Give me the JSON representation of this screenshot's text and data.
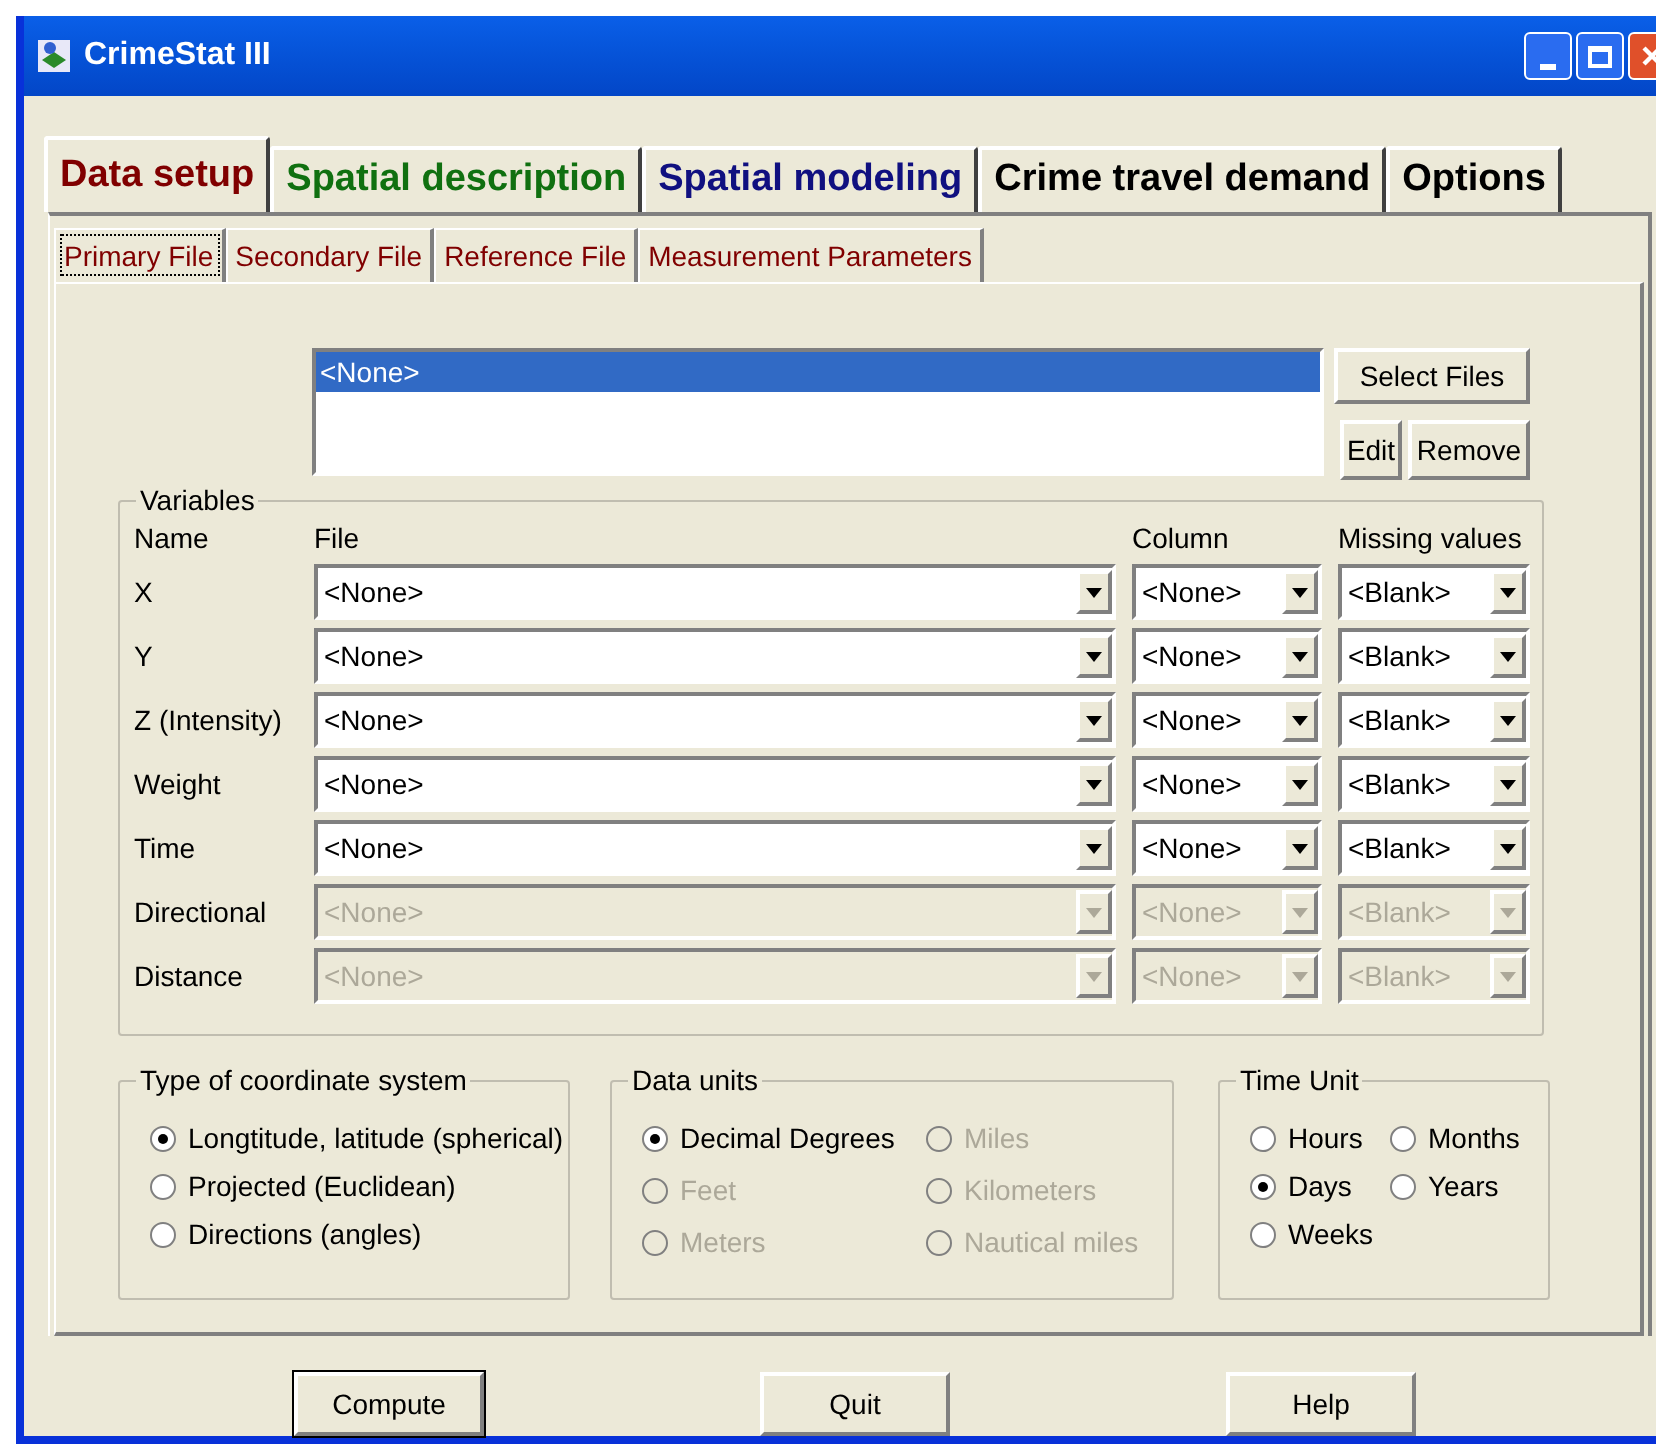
{
  "window": {
    "title": "CrimeStat III"
  },
  "tabs": [
    {
      "label": "Data setup",
      "selected": true,
      "color": "#800000"
    },
    {
      "label": "Spatial description",
      "selected": false,
      "color": "#107010"
    },
    {
      "label": "Spatial modeling",
      "selected": false,
      "color": "#101080"
    },
    {
      "label": "Crime travel demand",
      "selected": false,
      "color": "#000000"
    },
    {
      "label": "Options",
      "selected": false,
      "color": "#000000"
    }
  ],
  "subtabs": [
    {
      "label": "Primary File",
      "selected": true
    },
    {
      "label": "Secondary File",
      "selected": false
    },
    {
      "label": "Reference File",
      "selected": false
    },
    {
      "label": "Measurement Parameters",
      "selected": false
    }
  ],
  "file_list": {
    "items": [
      {
        "label": "<None>",
        "selected": true
      }
    ]
  },
  "file_buttons": [
    "Select Files",
    "Edit",
    "Remove"
  ],
  "variables": {
    "title": "Variables",
    "headers": [
      "Name",
      "File",
      "Column",
      "Missing values"
    ],
    "rows": [
      {
        "name": "X",
        "file": "<None>",
        "column": "<None>",
        "missing": "<Blank>",
        "disabled": false
      },
      {
        "name": "Y",
        "file": "<None>",
        "column": "<None>",
        "missing": "<Blank>",
        "disabled": false
      },
      {
        "name": "Z (Intensity)",
        "file": "<None>",
        "column": "<None>",
        "missing": "<Blank>",
        "disabled": false
      },
      {
        "name": "Weight",
        "file": "<None>",
        "column": "<None>",
        "missing": "<Blank>",
        "disabled": false
      },
      {
        "name": "Time",
        "file": "<None>",
        "column": "<None>",
        "missing": "<Blank>",
        "disabled": false
      },
      {
        "name": "Directional",
        "file": "<None>",
        "column": "<None>",
        "missing": "<Blank>",
        "disabled": true
      },
      {
        "name": "Distance",
        "file": "<None>",
        "column": "<None>",
        "missing": "<Blank>",
        "disabled": true
      }
    ]
  },
  "coordinate_system": {
    "title": "Type of coordinate system",
    "options": [
      {
        "label": "Longtitude, latitude (spherical)",
        "selected": true,
        "disabled": false
      },
      {
        "label": "Projected (Euclidean)",
        "selected": false,
        "disabled": false
      },
      {
        "label": "Directions (angles)",
        "selected": false,
        "disabled": false
      }
    ]
  },
  "data_units": {
    "title": "Data units",
    "options": [
      {
        "label": "Decimal Degrees",
        "selected": true,
        "disabled": false
      },
      {
        "label": "Miles",
        "selected": false,
        "disabled": true
      },
      {
        "label": "Feet",
        "selected": false,
        "disabled": true
      },
      {
        "label": "Kilometers",
        "selected": false,
        "disabled": true
      },
      {
        "label": "Meters",
        "selected": false,
        "disabled": true
      },
      {
        "label": "Nautical miles",
        "selected": false,
        "disabled": true
      }
    ]
  },
  "time_unit": {
    "title": "Time Unit",
    "options": [
      {
        "label": "Hours",
        "selected": false,
        "disabled": false
      },
      {
        "label": "Months",
        "selected": false,
        "disabled": false
      },
      {
        "label": "Days",
        "selected": true,
        "disabled": false
      },
      {
        "label": "Years",
        "selected": false,
        "disabled": false
      },
      {
        "label": "Weeks",
        "selected": false,
        "disabled": false
      }
    ]
  },
  "buttons": [
    {
      "label": "Compute",
      "default": true
    },
    {
      "label": "Quit",
      "default": false
    },
    {
      "label": "Help",
      "default": false
    }
  ]
}
